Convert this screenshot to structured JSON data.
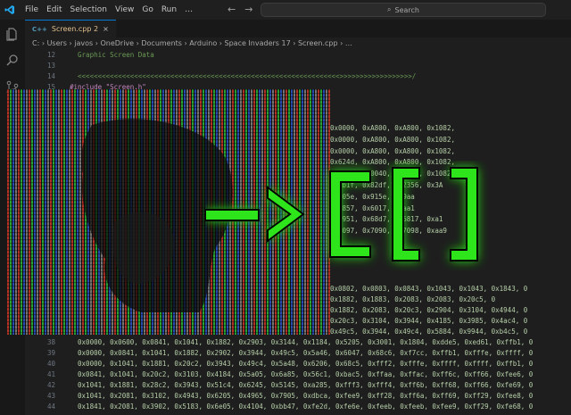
{
  "titlebar": {
    "menu": [
      "File",
      "Edit",
      "Selection",
      "View",
      "Go",
      "Run",
      "…"
    ],
    "search_placeholder": "Search"
  },
  "tab": {
    "ext": "C++",
    "label": "Screen.cpp 2",
    "close": "×"
  },
  "breadcrumb": "C: › Users › javos › OneDrive › Documents › Arduino › Space Invaders 17 › Screen.cpp › …",
  "lines": [
    {
      "n": "12",
      "text": "  Graphic Screen Data",
      "cls": "comment"
    },
    {
      "n": "13",
      "text": "",
      "cls": ""
    },
    {
      "n": "14",
      "text": "  <<<<<<<<<<<<<<<<<<<<<<<<<<<<<<<<<<<<<<<<<<<<<<<<<<<<<<<<<<<<<<<<<>>>>>>>>>>>>>>>>>>/",
      "cls": "comment"
    },
    {
      "n": "15",
      "text": "",
      "cls": ""
    },
    {
      "n": "16",
      "text": "#include \"Screen.h\"",
      "cls": "prep"
    },
    {
      "n": "17",
      "text": "",
      "cls": ""
    },
    {
      "n": "38",
      "text": "  0x0000, 0x0600, 0x0841, 0x1041, 0x1882, 0x2903, 0x3144, 0x1184, 0x5205, 0x3001, 0x1804, 0xdde5, 0xed61, 0xffb1, 0",
      "cls": ""
    },
    {
      "n": "39",
      "text": "  0x0000, 0x0841, 0x1041, 0x1882, 0x2902, 0x3944, 0x49c5, 0x5a46, 0x6047, 0x68c6, 0xf7cc, 0xffb1, 0xfffe, 0xffff, 0",
      "cls": ""
    },
    {
      "n": "40",
      "text": "  0x0000, 0x1041, 0x1881, 0x20c2, 0x3943, 0x49c4, 0x5a48, 0x6206, 0x68c5, 0xfff2, 0xfffe, 0xffff, 0xffff, 0xffb1, 0",
      "cls": ""
    },
    {
      "n": "41",
      "text": "  0x0841, 0x1041, 0x20c2, 0x3103, 0x4184, 0x5a05, 0x6a85, 0x56c1, 0xbac5, 0xffaa, 0xffac, 0xff6c, 0xff66, 0xfee6, 0",
      "cls": ""
    },
    {
      "n": "42",
      "text": "  0x1041, 0x1881, 0x28c2, 0x3943, 0x51c4, 0x6245, 0x5145, 0xa285, 0xfff3, 0xfff4, 0xff6b, 0xff68, 0xff66, 0xfe69, 0",
      "cls": ""
    },
    {
      "n": "43",
      "text": "  0x1041, 0x2081, 0x3102, 0x4943, 0x6205, 0x4965, 0x7905, 0xdbca, 0xfee9, 0xff28, 0xff6a, 0xff69, 0xff29, 0xfee8, 0",
      "cls": ""
    },
    {
      "n": "44",
      "text": "  0x1841, 0x2081, 0x3902, 0x5183, 0x6e05, 0x4104, 0xbb47, 0xfe2d, 0xfe6e, 0xfeeb, 0xfeeb, 0xfee9, 0xff29, 0xfe68, 0",
      "cls": ""
    }
  ],
  "partial_lines": [
    "0x0000, 0xA800, 0xA800, 0x1082,",
    "0x0000, 0xA800, 0xA800, 0x1082,",
    "0x0000, 0xA800, 0xA800, 0x1082,",
    "0x624d, 0xA800, 0xA800, 0x1082,",
    "0x621e, 0x0040, 0x0040, 0x1082,",
    "0x9b1f, 0x82df, 0x2356, 0x3A",
    "0x905e, 0x915e, 0x9aa",
    "0x7857, 0x6017, 0xaa1",
    "0x6951, 0x68d7, 0x6817, 0xa1",
    "0x7097, 0x7090, 0x7098, 0xaa9"
  ],
  "lower_partial": [
    "0x0802, 0x0803, 0x0843, 0x1043, 0x1043, 0x1843, 0",
    "0x1882, 0x1883, 0x2083, 0x2083, 0x20c5, 0",
    "0x1882, 0x2083, 0x20c3, 0x2904, 0x3104, 0x4944, 0",
    "0x20c3, 0x3104, 0x3944, 0x4185, 0x3985, 0x4ac4, 0",
    "0x49c5, 0x3944, 0x49c4, 0x5884, 0x9944, 0xb4c5, 0"
  ],
  "colors": {
    "accent": "#0078d4",
    "bg": "#1e1e1e",
    "art_green": "#27e81b"
  }
}
